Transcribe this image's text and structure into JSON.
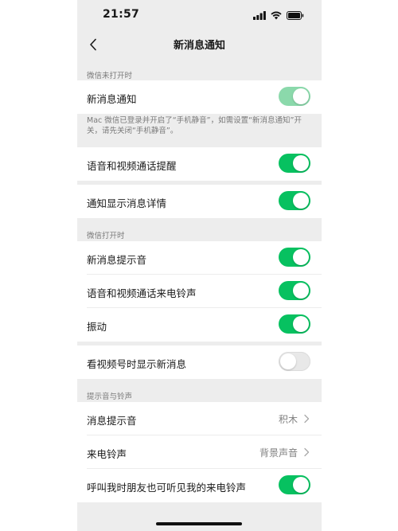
{
  "status_bar": {
    "time": "21:57"
  },
  "nav": {
    "title": "新消息通知"
  },
  "sections": {
    "not_open_header": "微信未打开时",
    "open_header": "微信打开时",
    "sound_header": "提示音与铃声"
  },
  "rows": {
    "new_message_notify": {
      "label": "新消息通知",
      "on": true
    },
    "call_reminder": {
      "label": "语音和视频通话提醒",
      "on": true
    },
    "show_details": {
      "label": "通知显示消息详情",
      "on": true
    },
    "message_sound": {
      "label": "新消息提示音",
      "on": true
    },
    "call_ringtone": {
      "label": "语音和视频通话来电铃声",
      "on": true
    },
    "vibrate": {
      "label": "振动",
      "on": true
    },
    "channels_show": {
      "label": "看视频号时显示新消息",
      "on": false
    },
    "msg_tone": {
      "label": "消息提示音",
      "value": "积木"
    },
    "incoming_ringtone": {
      "label": "来电铃声",
      "value": "背景声音"
    },
    "friends_hear": {
      "label": "呼叫我时朋友也可听见我的来电铃声",
      "on": true
    }
  },
  "note": "Mac 微信已登录并开启了“手机静音”，如需设置“新消息通知”开关，请先关闭“手机静音”。",
  "colors": {
    "accent": "#07c160",
    "background": "#ededed"
  }
}
